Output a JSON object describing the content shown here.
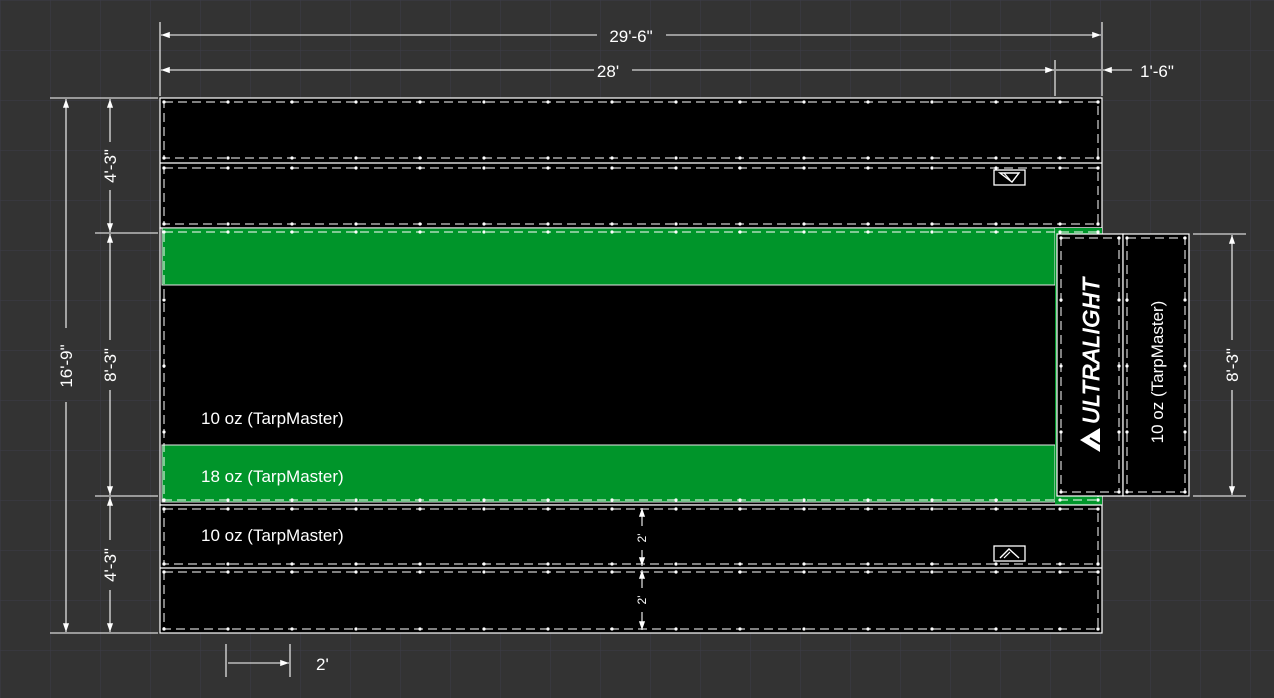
{
  "colors": {
    "background": "#333333",
    "grid": "#3d3d48",
    "tarp": "#000000",
    "accent_green": "#00952a",
    "line": "#ffffff"
  },
  "dimensions": {
    "overall_width": "29'-6\"",
    "main_width": "28'",
    "extension_width": "1'-6\"",
    "overall_height": "16'-9\"",
    "top_section": "4'-3\"",
    "middle_section": "8'-3\"",
    "bottom_section": "4'-3\"",
    "flap_height": "8'-3\"",
    "pocket_spacing": "2'",
    "pocket_height_upper": "2'",
    "pocket_height_lower": "2'"
  },
  "labels": {
    "middle_material": "10 oz (TarpMaster)",
    "band_material": "18 oz (TarpMaster)",
    "bottom_material": "10 oz (TarpMaster)",
    "flap_material": "10 oz (TarpMaster)",
    "brand": "ULTRALIGHT"
  },
  "icons": {
    "logo_top": "ultralight-logo-inverted-icon",
    "logo_bottom": "ultralight-logo-icon",
    "logo_flap": "ultralight-logo-icon"
  }
}
